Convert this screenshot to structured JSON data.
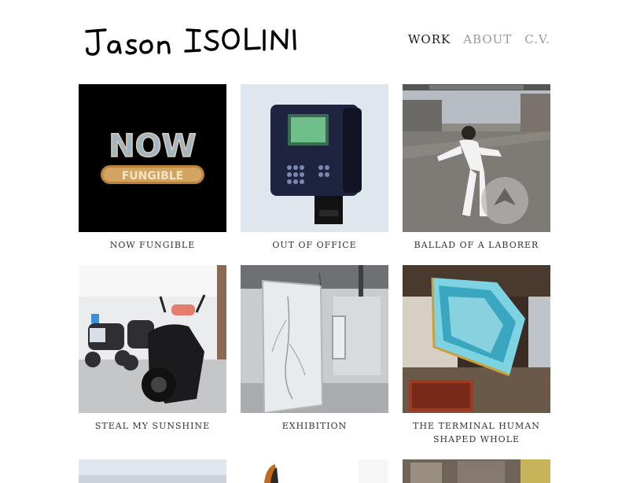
{
  "site": {
    "logo_text": "JASON ISOLINI"
  },
  "nav": {
    "items": [
      {
        "label": "WORK",
        "active": true
      },
      {
        "label": "ABOUT",
        "active": false
      },
      {
        "label": "C.V.",
        "active": false
      }
    ]
  },
  "works": [
    {
      "title": "NOW FUNGIBLE",
      "image_text_top": "NOW",
      "image_text_bottom": "FUNGIBLE"
    },
    {
      "title": "OUT OF OFFICE"
    },
    {
      "title": "BALLAD OF A LABORER"
    },
    {
      "title": "STEAL MY SUNSHINE"
    },
    {
      "title": "EXHIBITION"
    },
    {
      "title": "THE TERMINAL HUMAN SHAPED WHOLE"
    }
  ],
  "colors": {
    "nav_active": "#1a1a1a",
    "nav_inactive": "#9a9a9a",
    "caption": "#333333"
  }
}
